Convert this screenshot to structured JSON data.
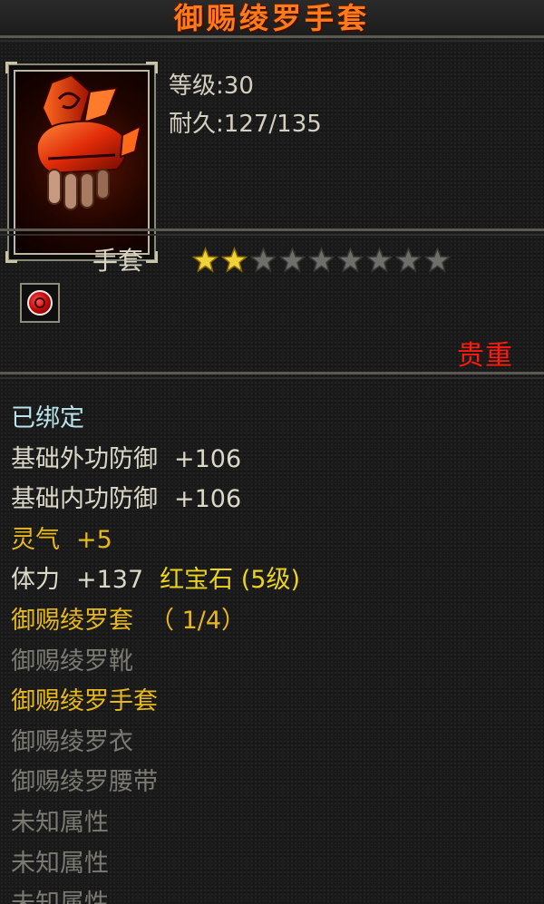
{
  "item": {
    "name": "御赐绫罗手套",
    "level_label": "等级",
    "level_value": "30",
    "durability_label": "耐久",
    "durability_value": "127/135",
    "type": "手套",
    "stars_filled": 2,
    "stars_total": 9,
    "rarity": "贵重",
    "icon": "red-glove-icon",
    "gem_icon": "red-gem-icon"
  },
  "attributes": {
    "bound": "已绑定",
    "outer_defense_label": "基础外功防御",
    "outer_defense_value": "+106",
    "inner_defense_label": "基础内功防御",
    "inner_defense_value": "+106",
    "spirit_label": "灵气",
    "spirit_value": "+5",
    "stamina_label": "体力",
    "stamina_value": "+137",
    "gem_bonus": "红宝石 (5级)"
  },
  "set": {
    "name": "御赐绫罗套",
    "progress": "（ 1/4）",
    "pieces": [
      {
        "name": "御赐绫罗靴",
        "owned": false
      },
      {
        "name": "御赐绫罗手套",
        "owned": true
      },
      {
        "name": "御赐绫罗衣",
        "owned": false
      },
      {
        "name": "御赐绫罗腰带",
        "owned": false
      }
    ]
  },
  "unknown_attributes": [
    "未知属性",
    "未知属性",
    "未知属性"
  ],
  "colors": {
    "title": "#ff7a1a",
    "rarity": "#ff1a10",
    "bound": "#b9e4ec",
    "base_attr": "#dcd8c8",
    "bonus_attr": "#e8b81a",
    "gem_attr": "#ecd41c",
    "inactive": "#7a7a72"
  }
}
